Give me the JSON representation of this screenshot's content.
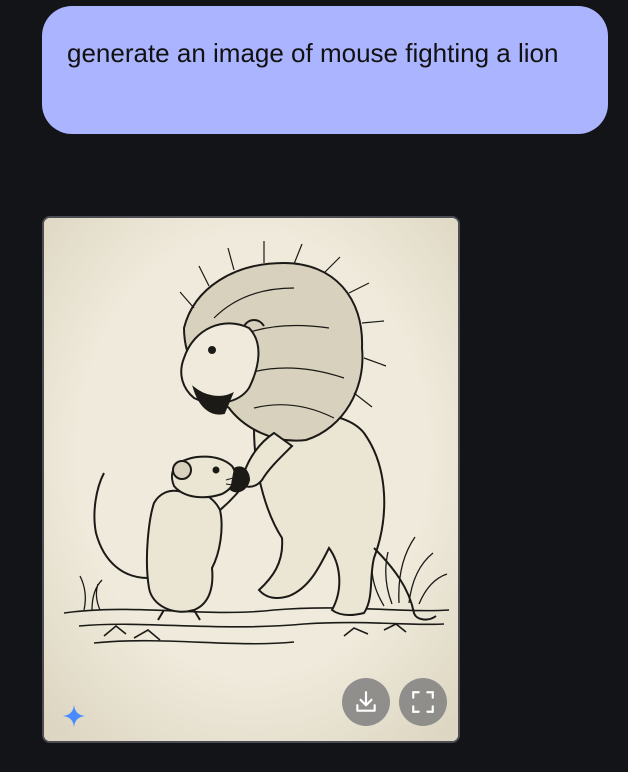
{
  "chat": {
    "user_message": {
      "text": "generate an image of mouse fighting a lion"
    },
    "generated_image": {
      "subject": "mouse-fighting-lion-sketch",
      "actions": {
        "download_icon": "download-icon",
        "fullscreen_icon": "fullscreen-icon"
      },
      "badge_icon": "sparkle-icon"
    }
  },
  "colors": {
    "background": "#131417",
    "user_bubble": "#abb4fe",
    "paper": "#efeadb",
    "ink": "#1b1a17",
    "action_button": "#808080",
    "sparkle": "#4a8cff"
  }
}
